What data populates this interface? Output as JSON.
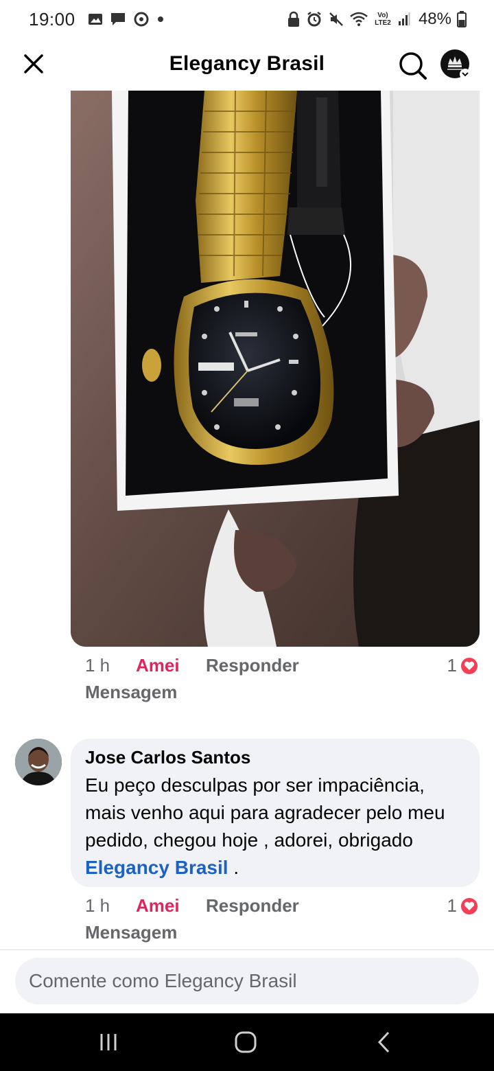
{
  "status_bar": {
    "time": "19:00",
    "battery": "48%",
    "network_label": "Vo) LTE2",
    "left_icons": [
      "gallery-icon",
      "message-icon",
      "sync-icon",
      "dot-icon"
    ],
    "right_icons": [
      "lock-icon",
      "alarm-icon",
      "mute-icon",
      "wifi-icon",
      "signal-icon",
      "battery-icon"
    ]
  },
  "header": {
    "title": "Elegancy Brasil",
    "icons": [
      "close-icon",
      "search-icon",
      "profile-avatar-icon"
    ]
  },
  "first_comment_meta": {
    "time": "1 h",
    "reaction_label": "Amei",
    "reply_label": "Responder",
    "message_label": "Mensagem",
    "reaction_count": "1"
  },
  "comment": {
    "author": "Jose Carlos Santos",
    "text": "Eu peço desculpas por  ser impaciência, mais venho aqui para agradecer pelo meu pedido, chegou hoje , adorei, obrigado ",
    "mention": "Elegancy Brasil",
    "text_end": " .",
    "time": "1 h",
    "reaction_label": "Amei",
    "reply_label": "Responder",
    "message_label": "Mensagem",
    "reaction_count": "1"
  },
  "composer": {
    "placeholder": "Comente como Elegancy Brasil"
  },
  "colors": {
    "accent_reaction": "#e0245e",
    "mention": "#1b61c6",
    "bubble": "#f0f2f5",
    "secondary_text": "#65676b"
  }
}
